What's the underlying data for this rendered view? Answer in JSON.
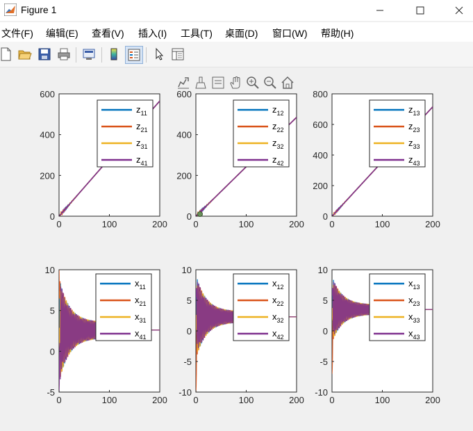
{
  "window": {
    "title": "Figure 1",
    "minimize_icon": "minimize-icon",
    "maximize_icon": "maximize-icon",
    "close_icon": "close-icon"
  },
  "menu": {
    "items": [
      "文件(F)",
      "编辑(E)",
      "查看(V)",
      "插入(I)",
      "工具(T)",
      "桌面(D)",
      "窗口(W)",
      "帮助(H)"
    ]
  },
  "toolbar": {
    "icons": [
      "new-figure-icon",
      "open-file-icon",
      "save-icon",
      "print-icon",
      "link-plot-icon",
      "colorbar-icon",
      "legend-icon",
      "pointer-icon",
      "property-inspector-icon"
    ]
  },
  "axes_toolbar": {
    "icons": [
      "export-icon",
      "brush-icon",
      "data-tips-icon",
      "pan-icon",
      "zoom-in-icon",
      "zoom-out-icon",
      "home-icon"
    ]
  },
  "colors": {
    "series1": "#0072bd",
    "series2": "#d95319",
    "series3": "#edb120",
    "series4": "#7e2f8e"
  },
  "chart_data": [
    {
      "type": "line",
      "xlim": [
        0,
        200
      ],
      "ylim": [
        0,
        600
      ],
      "xticks": [
        0,
        100,
        200
      ],
      "yticks": [
        0,
        200,
        400,
        600
      ],
      "legend": [
        "z11",
        "z21",
        "z31",
        "z41"
      ],
      "legend_position": "top-right",
      "series": [
        {
          "name": "z11",
          "x": [
            0,
            200
          ],
          "y": [
            0,
            565
          ]
        },
        {
          "name": "z21",
          "x": [
            0,
            200
          ],
          "y": [
            0,
            565
          ]
        },
        {
          "name": "z31",
          "x": [
            0,
            200
          ],
          "y": [
            0,
            565
          ]
        },
        {
          "name": "z41",
          "x": [
            0,
            200
          ],
          "y": [
            0,
            565
          ]
        }
      ]
    },
    {
      "type": "line",
      "xlim": [
        0,
        200
      ],
      "ylim": [
        0,
        600
      ],
      "xticks": [
        0,
        100,
        200
      ],
      "yticks": [
        0,
        200,
        400,
        600
      ],
      "legend": [
        "z12",
        "z22",
        "z32",
        "z42"
      ],
      "legend_position": "top-right",
      "series": [
        {
          "name": "z12",
          "x": [
            0,
            200
          ],
          "y": [
            0,
            485
          ]
        },
        {
          "name": "z22",
          "x": [
            0,
            200
          ],
          "y": [
            0,
            485
          ]
        },
        {
          "name": "z32",
          "x": [
            0,
            200
          ],
          "y": [
            0,
            485
          ]
        },
        {
          "name": "z42",
          "x": [
            0,
            200
          ],
          "y": [
            0,
            485
          ]
        }
      ]
    },
    {
      "type": "line",
      "xlim": [
        0,
        200
      ],
      "ylim": [
        0,
        800
      ],
      "xticks": [
        0,
        100,
        200
      ],
      "yticks": [
        0,
        200,
        400,
        600,
        800
      ],
      "legend": [
        "z13",
        "z23",
        "z33",
        "z43"
      ],
      "legend_position": "top-right",
      "series": [
        {
          "name": "z13",
          "x": [
            0,
            200
          ],
          "y": [
            0,
            715
          ]
        },
        {
          "name": "z23",
          "x": [
            0,
            200
          ],
          "y": [
            0,
            715
          ]
        },
        {
          "name": "z33",
          "x": [
            0,
            200
          ],
          "y": [
            0,
            715
          ]
        },
        {
          "name": "z43",
          "x": [
            0,
            200
          ],
          "y": [
            0,
            715
          ]
        }
      ]
    },
    {
      "type": "line",
      "xlim": [
        0,
        200
      ],
      "ylim": [
        -5,
        10
      ],
      "xticks": [
        0,
        100,
        200
      ],
      "yticks": [
        -5,
        0,
        5,
        10
      ],
      "legend": [
        "x11",
        "x21",
        "x31",
        "x41"
      ],
      "legend_position": "top-right",
      "oscillation": {
        "steady": 2.6,
        "initial_amplitude": 6.5,
        "decay_end_x": 80,
        "tail_amplitude": 1.0
      },
      "initial_values": [
        6.5,
        10,
        2.6,
        -5
      ]
    },
    {
      "type": "line",
      "xlim": [
        0,
        200
      ],
      "ylim": [
        -10,
        10
      ],
      "xticks": [
        0,
        100,
        200
      ],
      "yticks": [
        -10,
        -5,
        0,
        5,
        10
      ],
      "legend": [
        "x12",
        "x22",
        "x32",
        "x42"
      ],
      "legend_position": "top-right",
      "oscillation": {
        "steady": 2.3,
        "initial_amplitude": 7,
        "decay_end_x": 80,
        "tail_amplitude": 0.9
      },
      "initial_values": [
        6.5,
        -10,
        2.3,
        6.5
      ]
    },
    {
      "type": "line",
      "xlim": [
        0,
        200
      ],
      "ylim": [
        -10,
        10
      ],
      "xticks": [
        0,
        100,
        200
      ],
      "yticks": [
        -10,
        -5,
        0,
        5,
        10
      ],
      "legend": [
        "x13",
        "x23",
        "x33",
        "x43"
      ],
      "legend_position": "top-right",
      "oscillation": {
        "steady": 3.5,
        "initial_amplitude": 5.5,
        "decay_end_x": 80,
        "tail_amplitude": 0.8
      },
      "initial_values": [
        6.5,
        -7,
        3.5,
        6.5
      ]
    }
  ]
}
